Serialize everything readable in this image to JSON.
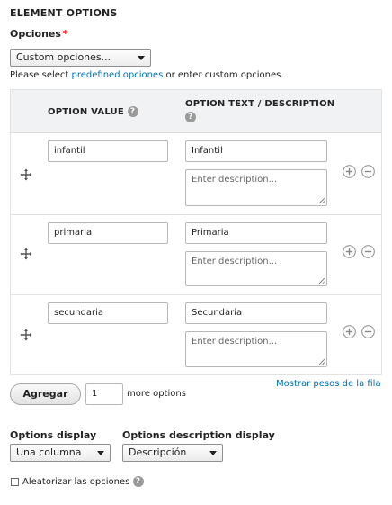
{
  "section_title": "ELEMENT OPTIONS",
  "opciones": {
    "label": "Opciones",
    "required_mark": "*",
    "select_value": "Custom opciones...",
    "description_prefix": "Please select ",
    "description_link": "predefined opciones",
    "description_suffix": " or enter custom opciones."
  },
  "table": {
    "col_value": "OPTION VALUE",
    "col_text": "OPTION TEXT / DESCRIPTION",
    "help_glyph": "?",
    "rows": [
      {
        "value": "infantil",
        "text": "Infantil",
        "description_placeholder": "Enter description..."
      },
      {
        "value": "primaria",
        "text": "Primaria",
        "description_placeholder": "Enter description..."
      },
      {
        "value": "secundaria",
        "text": "Secundaria",
        "description_placeholder": "Enter description..."
      }
    ]
  },
  "show_weights_link": "Mostrar pesos de la fila",
  "add": {
    "button_label": "Agregar",
    "count_value": "1",
    "suffix": "more options"
  },
  "options_display": {
    "label": "Options display",
    "select_value": "Una columna"
  },
  "options_description_display": {
    "label": "Options description display",
    "select_value": "Descripción"
  },
  "randomize": {
    "label": "Aleatorizar las opciones",
    "checked": false
  }
}
